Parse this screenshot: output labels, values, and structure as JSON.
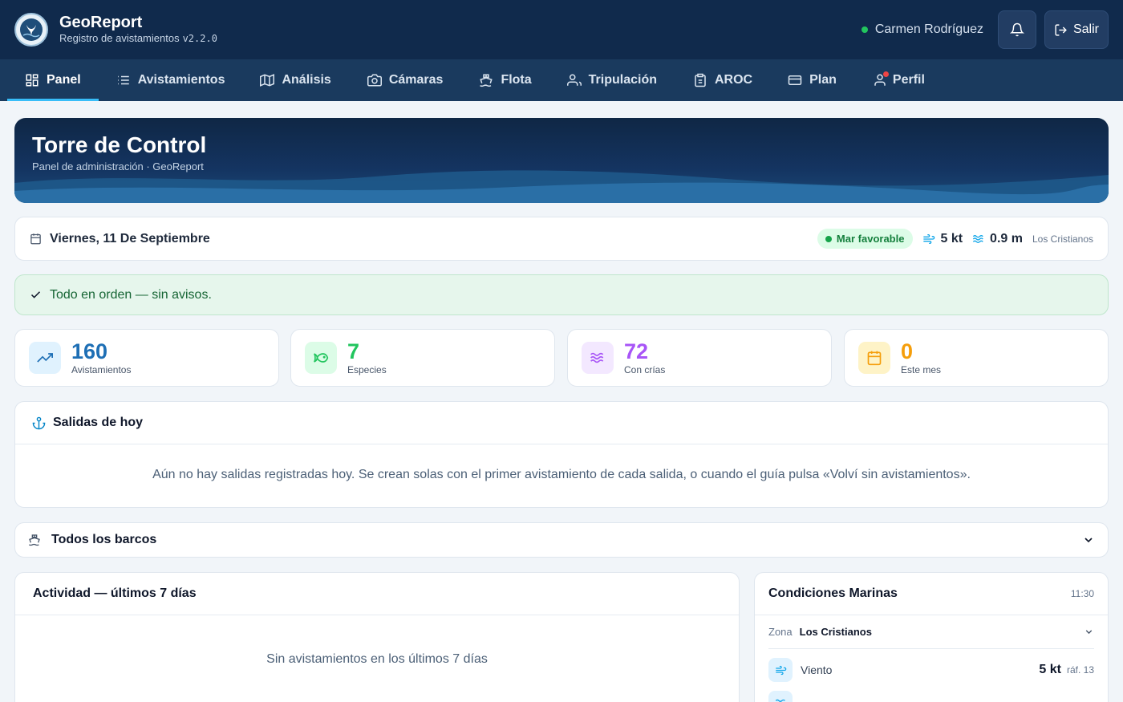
{
  "app": {
    "name": "GeoReport",
    "subtitle": "Registro de avistamientos",
    "version": "v2.2.0",
    "user": "Carmen Rodríguez",
    "logout_label": "Salir"
  },
  "nav": {
    "items": [
      {
        "label": "Panel",
        "icon": "grid-icon",
        "active": true
      },
      {
        "label": "Avistamientos",
        "icon": "list-icon"
      },
      {
        "label": "Análisis",
        "icon": "map-icon"
      },
      {
        "label": "Cámaras",
        "icon": "camera-icon"
      },
      {
        "label": "Flota",
        "icon": "ship-icon"
      },
      {
        "label": "Tripulación",
        "icon": "users-icon"
      },
      {
        "label": "AROC",
        "icon": "clipboard-icon"
      },
      {
        "label": "Plan",
        "icon": "card-icon"
      },
      {
        "label": "Perfil",
        "icon": "user-icon",
        "notification": true
      }
    ]
  },
  "hero": {
    "title": "Torre de Control",
    "subtitle": "Panel de administración · GeoReport"
  },
  "datebar": {
    "date": "Viernes, 11 De Septiembre",
    "sea_status": "Mar favorable",
    "wind": "5 kt",
    "wave": "0.9 m",
    "location": "Los Cristianos"
  },
  "alert": {
    "text": "Todo en orden — sin avisos."
  },
  "stats": [
    {
      "value": "160",
      "label": "Avistamientos",
      "color": "#1e6fb5",
      "bg": "#e0f2fe",
      "icon": "trend-up-icon"
    },
    {
      "value": "7",
      "label": "Especies",
      "color": "#22c55e",
      "bg": "#dcfce7",
      "icon": "fish-icon"
    },
    {
      "value": "72",
      "label": "Con crías",
      "color": "#a855f7",
      "bg": "#f3e8ff",
      "icon": "waves-icon"
    },
    {
      "value": "0",
      "label": "Este mes",
      "color": "#f59e0b",
      "bg": "#fef3c7",
      "icon": "calendar-icon"
    }
  ],
  "salidas": {
    "title": "Salidas de hoy",
    "empty": "Aún no hay salidas registradas hoy. Se crean solas con el primer avistamiento de cada salida, o cuando el guía pulsa «Volví sin avistamientos»."
  },
  "boats": {
    "selected": "Todos los barcos"
  },
  "activity": {
    "title": "Actividad — últimos 7 días",
    "empty": "Sin avistamientos en los últimos 7 días"
  },
  "conditions": {
    "title": "Condiciones Marinas",
    "time": "11:30",
    "zone_label": "Zona",
    "zone_value": "Los Cristianos",
    "rows": [
      {
        "label": "Viento",
        "value": "5 kt",
        "extra": "ráf. 13",
        "icon": "wind-icon"
      }
    ]
  }
}
